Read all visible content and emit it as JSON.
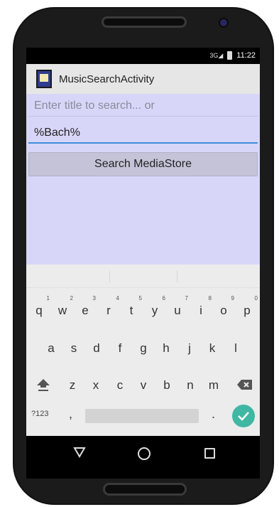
{
  "statusbar": {
    "network": "3G",
    "time": "11:22"
  },
  "app": {
    "title": "MusicSearchActivity"
  },
  "form": {
    "title_placeholder": "Enter title to search... or",
    "query_value": "%Bach%",
    "search_button": "Search MediaStore"
  },
  "keyboard": {
    "row1": [
      {
        "key": "q",
        "hint": "1"
      },
      {
        "key": "w",
        "hint": "2"
      },
      {
        "key": "e",
        "hint": "3"
      },
      {
        "key": "r",
        "hint": "4"
      },
      {
        "key": "t",
        "hint": "5"
      },
      {
        "key": "y",
        "hint": "6"
      },
      {
        "key": "u",
        "hint": "7"
      },
      {
        "key": "i",
        "hint": "8"
      },
      {
        "key": "o",
        "hint": "9"
      },
      {
        "key": "p",
        "hint": "0"
      }
    ],
    "row2": [
      "a",
      "s",
      "d",
      "f",
      "g",
      "h",
      "j",
      "k",
      "l"
    ],
    "row3": [
      "z",
      "x",
      "c",
      "v",
      "b",
      "n",
      "m"
    ],
    "symbols_key": "?123",
    "comma": ",",
    "period": "."
  },
  "colors": {
    "content_bg": "#d8d6f8",
    "accent": "#3d8ed8",
    "enter_key": "#3fb7a3"
  }
}
